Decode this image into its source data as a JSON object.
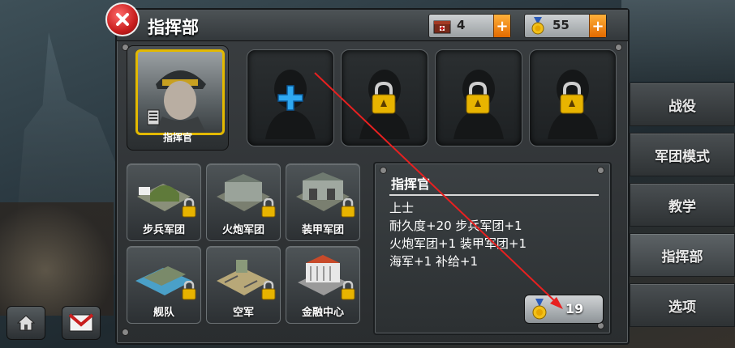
{
  "header": {
    "title": "指挥部",
    "resources": [
      {
        "icon": "supply-crate-icon",
        "value": "4",
        "plus": "+"
      },
      {
        "icon": "medal-icon",
        "value": "55",
        "plus": "+"
      }
    ]
  },
  "commander": {
    "label": "指挥官"
  },
  "units": [
    {
      "label": "步兵军团",
      "icon": "infantry-building-icon"
    },
    {
      "label": "火炮军团",
      "icon": "artillery-building-icon"
    },
    {
      "label": "装甲军团",
      "icon": "armor-building-icon"
    },
    {
      "label": "舰队",
      "icon": "fleet-building-icon"
    },
    {
      "label": "空军",
      "icon": "airforce-building-icon"
    },
    {
      "label": "金融中心",
      "icon": "finance-center-icon"
    }
  ],
  "info": {
    "title": "指挥官",
    "lines": [
      "上士",
      "耐久度+20  步兵军团+1",
      "火炮军团+1  装甲军团+1",
      "海军+1  补给+1"
    ],
    "cost": "19"
  },
  "menu": [
    "战役",
    "军团模式",
    "教学",
    "指挥部",
    "选项"
  ],
  "colors": {
    "accent": "#e3b900",
    "plus_button": "#f08a00",
    "close": "#d42222",
    "annotation_arrow": "#e82020"
  }
}
